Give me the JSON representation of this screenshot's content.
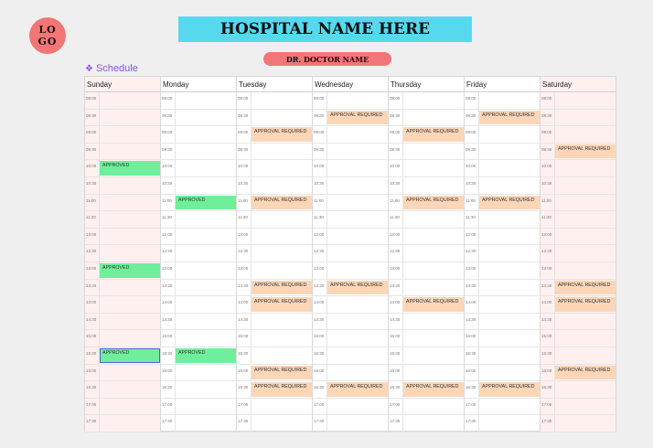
{
  "header": {
    "logo_line1": "LO",
    "logo_line2": "GO",
    "hospital_name": "HOSPITAL NAME HERE",
    "doctor_name": "DR. DOCTOR NAME",
    "schedule_label": "Schedule",
    "schedule_icon": "diamond-grid-icon"
  },
  "colors": {
    "approved": "#6fef9b",
    "approval_required": "#fdd6b8",
    "hospital_banner": "#56d9ef",
    "logo": "#f47575",
    "weekend": "#fdf0ef",
    "accent": "#8a55e0"
  },
  "days": [
    "Sunday",
    "Monday",
    "Tuesday",
    "Wednesday",
    "Thursday",
    "Friday",
    "Saturday"
  ],
  "times": [
    "08:00",
    "08:30",
    "09:00",
    "09:30",
    "10:00",
    "10:30",
    "11:00",
    "11:30",
    "12:00",
    "12:30",
    "13:00",
    "13:30",
    "14:00",
    "14:30",
    "15:00",
    "15:30",
    "16:00",
    "16:30",
    "17:00",
    "17:30"
  ],
  "appointments": [
    {
      "day": 0,
      "slot": 4,
      "label": "APPROVED",
      "status": "approved"
    },
    {
      "day": 0,
      "slot": 10,
      "label": "APPROVED",
      "status": "approved"
    },
    {
      "day": 0,
      "slot": 15,
      "label": "APPROVED",
      "status": "approved",
      "selected": true
    },
    {
      "day": 1,
      "slot": 6,
      "label": "APPROVED",
      "status": "approved"
    },
    {
      "day": 1,
      "slot": 15,
      "label": "APPROVED",
      "status": "approved"
    },
    {
      "day": 2,
      "slot": 2,
      "label": "APPROVAL REQUIRED",
      "status": "pending"
    },
    {
      "day": 2,
      "slot": 6,
      "label": "APPROVAL REQUIRED",
      "status": "pending"
    },
    {
      "day": 2,
      "slot": 11,
      "label": "APPROVAL REQUIRED",
      "status": "pending"
    },
    {
      "day": 2,
      "slot": 12,
      "label": "APPROVAL REQUIRED",
      "status": "pending"
    },
    {
      "day": 2,
      "slot": 16,
      "label": "APPROVAL REQUIRED",
      "status": "pending"
    },
    {
      "day": 2,
      "slot": 17,
      "label": "APPROVAL REQUIRED",
      "status": "pending"
    },
    {
      "day": 3,
      "slot": 1,
      "label": "APPROVAL REQUIRED",
      "status": "pending"
    },
    {
      "day": 3,
      "slot": 11,
      "label": "APPROVAL REQUIRED",
      "status": "pending"
    },
    {
      "day": 3,
      "slot": 17,
      "label": "APPROVAL REQUIRED",
      "status": "pending"
    },
    {
      "day": 4,
      "slot": 2,
      "label": "APPROVAL REQUIRED",
      "status": "pending"
    },
    {
      "day": 4,
      "slot": 6,
      "label": "APPROVAL REQUIRED",
      "status": "pending"
    },
    {
      "day": 4,
      "slot": 12,
      "label": "APPROVAL REQUIRED",
      "status": "pending"
    },
    {
      "day": 4,
      "slot": 17,
      "label": "APPROVAL REQUIRED",
      "status": "pending"
    },
    {
      "day": 5,
      "slot": 1,
      "label": "APPROVAL REQUIRED",
      "status": "pending"
    },
    {
      "day": 5,
      "slot": 6,
      "label": "APPROVAL REQUIRED",
      "status": "pending"
    },
    {
      "day": 5,
      "slot": 17,
      "label": "APPROVAL REQUIRED",
      "status": "pending"
    },
    {
      "day": 6,
      "slot": 3,
      "label": "APPROVAL REQUIRED",
      "status": "pending"
    },
    {
      "day": 6,
      "slot": 11,
      "label": "APPROVAL REQUIRED",
      "status": "pending"
    },
    {
      "day": 6,
      "slot": 12,
      "label": "APPROVAL REQUIRED",
      "status": "pending"
    },
    {
      "day": 6,
      "slot": 16,
      "label": "APPROVAL REQUIRED",
      "status": "pending"
    }
  ]
}
